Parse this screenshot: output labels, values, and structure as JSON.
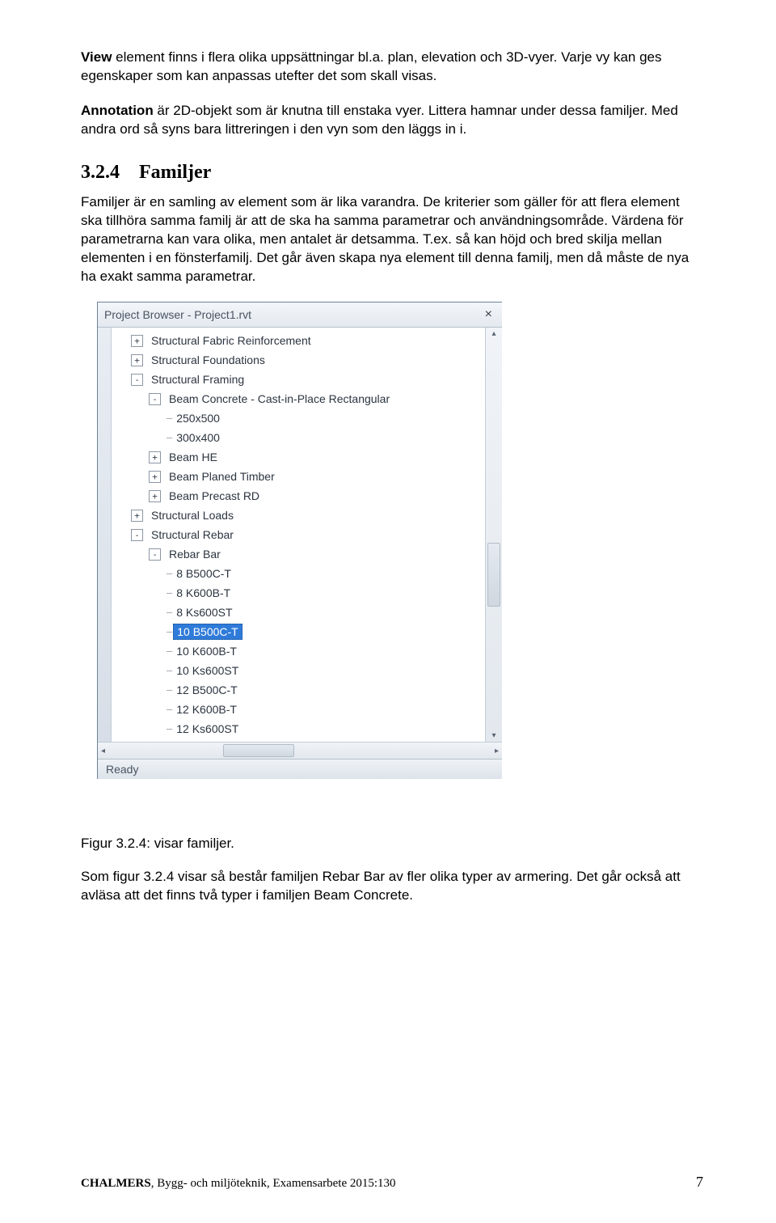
{
  "paragraphs": {
    "p1a": "View",
    "p1b": " element finns i flera olika uppsättningar bl.a. plan, elevation och 3D-vyer. Varje vy kan ges egenskaper som kan anpassas utefter det som skall visas.",
    "p2a": "Annotation",
    "p2b": " är 2D-objekt som är knutna till enstaka vyer. Littera hamnar under dessa familjer. Med andra ord så syns bara littreringen i den vyn som den läggs in i.",
    "p3": "Familjer är en samling av element som är lika varandra. De kriterier som gäller för att flera element ska tillhöra samma familj är att de ska ha samma parametrar och användningsområde. Värdena för parametrarna kan vara olika, men antalet är detsamma. T.ex. så kan höjd och bred skilja mellan elementen i en fönsterfamilj. Det går även skapa nya element till denna familj, men då måste de nya ha exakt samma parametrar.",
    "p4": "Som figur 3.2.4 visar så består familjen Rebar Bar av fler olika typer av armering. Det går också att avläsa att det finns två typer i familjen Beam Concrete."
  },
  "heading": {
    "num": "3.2.4",
    "text": "Familjer"
  },
  "figcap": "Figur 3.2.4: visar familjer.",
  "footer": {
    "org": "CHALMERS",
    "rest": ", Bygg- och miljöteknik, Examensarbete 2015:130",
    "page": "7"
  },
  "panel": {
    "title": "Project Browser - Project1.rvt",
    "status": "Ready",
    "tree": [
      {
        "indent": 1,
        "box": "+",
        "label": "Structural Fabric Reinforcement"
      },
      {
        "indent": 1,
        "box": "+",
        "label": "Structural Foundations"
      },
      {
        "indent": 1,
        "box": "-",
        "label": "Structural Framing"
      },
      {
        "indent": 2,
        "box": "-",
        "label": "Beam Concrete - Cast-in-Place Rectangular"
      },
      {
        "indent": 3,
        "box": "",
        "label": "250x500"
      },
      {
        "indent": 3,
        "box": "",
        "label": "300x400"
      },
      {
        "indent": 2,
        "box": "+",
        "label": "Beam HE"
      },
      {
        "indent": 2,
        "box": "+",
        "label": "Beam Planed Timber"
      },
      {
        "indent": 2,
        "box": "+",
        "label": "Beam Precast RD"
      },
      {
        "indent": 1,
        "box": "+",
        "label": "Structural Loads"
      },
      {
        "indent": 1,
        "box": "-",
        "label": "Structural Rebar"
      },
      {
        "indent": 2,
        "box": "-",
        "label": "Rebar Bar"
      },
      {
        "indent": 3,
        "box": "",
        "label": "8 B500C-T"
      },
      {
        "indent": 3,
        "box": "",
        "label": "8 K600B-T"
      },
      {
        "indent": 3,
        "box": "",
        "label": "8 Ks600ST"
      },
      {
        "indent": 3,
        "box": "",
        "label": "10 B500C-T",
        "selected": true
      },
      {
        "indent": 3,
        "box": "",
        "label": "10 K600B-T"
      },
      {
        "indent": 3,
        "box": "",
        "label": "10 Ks600ST"
      },
      {
        "indent": 3,
        "box": "",
        "label": "12 B500C-T"
      },
      {
        "indent": 3,
        "box": "",
        "label": "12 K600B-T"
      },
      {
        "indent": 3,
        "box": "",
        "label": "12 Ks600ST"
      }
    ]
  }
}
